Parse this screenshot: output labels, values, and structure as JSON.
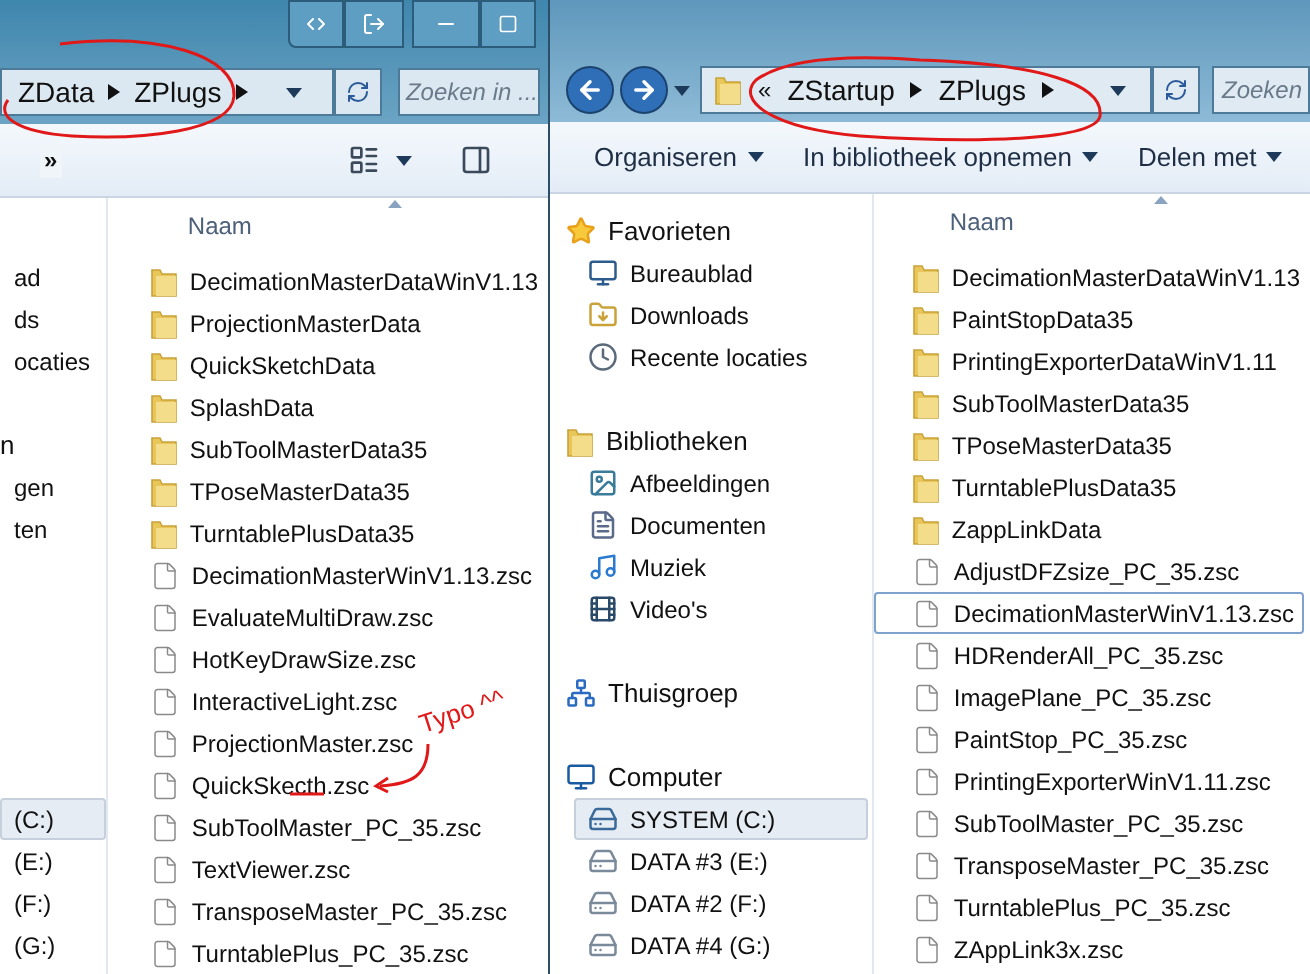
{
  "left_window": {
    "address_bar": {
      "crumbs": [
        "ZData",
        "ZPlugs"
      ]
    },
    "search": {
      "placeholder": "Zoeken in ..."
    },
    "toolbar": {
      "overflow": "»"
    },
    "sidebar": {
      "groups": [
        {
          "items": [
            {
              "label": "ad",
              "selected": false
            },
            {
              "label": "ds",
              "selected": false
            },
            {
              "label": "ocaties",
              "selected": false
            }
          ]
        },
        {
          "header": "n",
          "items": [
            {
              "label": "gen",
              "selected": false
            },
            {
              "label": "ten",
              "selected": false
            }
          ]
        },
        {
          "items": [
            {
              "label": "(C:)",
              "selected": true
            },
            {
              "label": "(E:)",
              "selected": false
            },
            {
              "label": "(F:)",
              "selected": false
            },
            {
              "label": "(G:)",
              "selected": false
            }
          ]
        }
      ]
    },
    "file_list": {
      "column": "Naam",
      "rows": [
        {
          "name": "DecimationMasterDataWinV1.13",
          "kind": "folder",
          "selected": false
        },
        {
          "name": "ProjectionMasterData",
          "kind": "folder",
          "selected": false
        },
        {
          "name": "QuickSketchData",
          "kind": "folder",
          "selected": false
        },
        {
          "name": "SplashData",
          "kind": "folder",
          "selected": false
        },
        {
          "name": "SubToolMasterData35",
          "kind": "folder",
          "selected": false
        },
        {
          "name": "TPoseMasterData35",
          "kind": "folder",
          "selected": false
        },
        {
          "name": "TurntablePlusData35",
          "kind": "folder",
          "selected": false
        },
        {
          "name": "DecimationMasterWinV1.13.zsc",
          "kind": "file",
          "selected": false
        },
        {
          "name": "EvaluateMultiDraw.zsc",
          "kind": "file",
          "selected": false
        },
        {
          "name": "HotKeyDrawSize.zsc",
          "kind": "file",
          "selected": false
        },
        {
          "name": "InteractiveLight.zsc",
          "kind": "file",
          "selected": false
        },
        {
          "name": "ProjectionMaster.zsc",
          "kind": "file",
          "selected": false
        },
        {
          "name": "QuickSkecth.zsc",
          "kind": "file",
          "selected": false
        },
        {
          "name": "SubToolMaster_PC_35.zsc",
          "kind": "file",
          "selected": false
        },
        {
          "name": "TextViewer.zsc",
          "kind": "file",
          "selected": false
        },
        {
          "name": "TransposeMaster_PC_35.zsc",
          "kind": "file",
          "selected": false
        },
        {
          "name": "TurntablePlus_PC_35.zsc",
          "kind": "file",
          "selected": false
        }
      ]
    }
  },
  "right_window": {
    "address_bar": {
      "overflow": "«",
      "crumbs": [
        "ZStartup",
        "ZPlugs"
      ]
    },
    "search": {
      "placeholder": "Zoeken"
    },
    "toolbar": {
      "buttons": [
        "Organiseren",
        "In bibliotheek opnemen",
        "Delen met"
      ]
    },
    "sidebar": {
      "groups": [
        {
          "header": "Favorieten",
          "kind": "favorites",
          "items": [
            {
              "label": "Bureaublad",
              "kind": "desktop",
              "selected": false
            },
            {
              "label": "Downloads",
              "kind": "downloads",
              "selected": false
            },
            {
              "label": "Recente locaties",
              "kind": "recent",
              "selected": false
            }
          ]
        },
        {
          "header": "Bibliotheken",
          "kind": "libraries",
          "items": [
            {
              "label": "Afbeeldingen",
              "kind": "pictures",
              "selected": false
            },
            {
              "label": "Documenten",
              "kind": "documents",
              "selected": false
            },
            {
              "label": "Muziek",
              "kind": "music",
              "selected": false
            },
            {
              "label": "Video's",
              "kind": "videos",
              "selected": false
            }
          ]
        },
        {
          "header": "Thuisgroep",
          "kind": "homegroup"
        },
        {
          "header": "Computer",
          "kind": "computer",
          "items": [
            {
              "label": "SYSTEM (C:)",
              "kind": "system_drive",
              "selected": true
            },
            {
              "label": "DATA #3 (E:)",
              "kind": "drive",
              "selected": false
            },
            {
              "label": "DATA #2 (F:)",
              "kind": "drive",
              "selected": false
            },
            {
              "label": "DATA #4 (G:)",
              "kind": "drive",
              "selected": false
            }
          ]
        }
      ]
    },
    "file_list": {
      "column": "Naam",
      "rows": [
        {
          "name": "DecimationMasterDataWinV1.13",
          "kind": "folder",
          "selected": false
        },
        {
          "name": "PaintStopData35",
          "kind": "folder",
          "selected": false
        },
        {
          "name": "PrintingExporterDataWinV1.11",
          "kind": "folder",
          "selected": false
        },
        {
          "name": "SubToolMasterData35",
          "kind": "folder",
          "selected": false
        },
        {
          "name": "TPoseMasterData35",
          "kind": "folder",
          "selected": false
        },
        {
          "name": "TurntablePlusData35",
          "kind": "folder",
          "selected": false
        },
        {
          "name": "ZappLinkData",
          "kind": "folder",
          "selected": false
        },
        {
          "name": "AdjustDFZsize_PC_35.zsc",
          "kind": "file",
          "selected": false
        },
        {
          "name": "DecimationMasterWinV1.13.zsc",
          "kind": "file",
          "selected": true
        },
        {
          "name": "HDRenderAll_PC_35.zsc",
          "kind": "file",
          "selected": false
        },
        {
          "name": "ImagePlane_PC_35.zsc",
          "kind": "file",
          "selected": false
        },
        {
          "name": "PaintStop_PC_35.zsc",
          "kind": "file",
          "selected": false
        },
        {
          "name": "PrintingExporterWinV1.11.zsc",
          "kind": "file",
          "selected": false
        },
        {
          "name": "SubToolMaster_PC_35.zsc",
          "kind": "file",
          "selected": false
        },
        {
          "name": "TransposeMaster_PC_35.zsc",
          "kind": "file",
          "selected": false
        },
        {
          "name": "TurntablePlus_PC_35.zsc",
          "kind": "file",
          "selected": false
        },
        {
          "name": "ZAppLink3x.zsc",
          "kind": "file",
          "selected": false
        }
      ]
    }
  },
  "annotation": {
    "note": "Typo ^^"
  }
}
